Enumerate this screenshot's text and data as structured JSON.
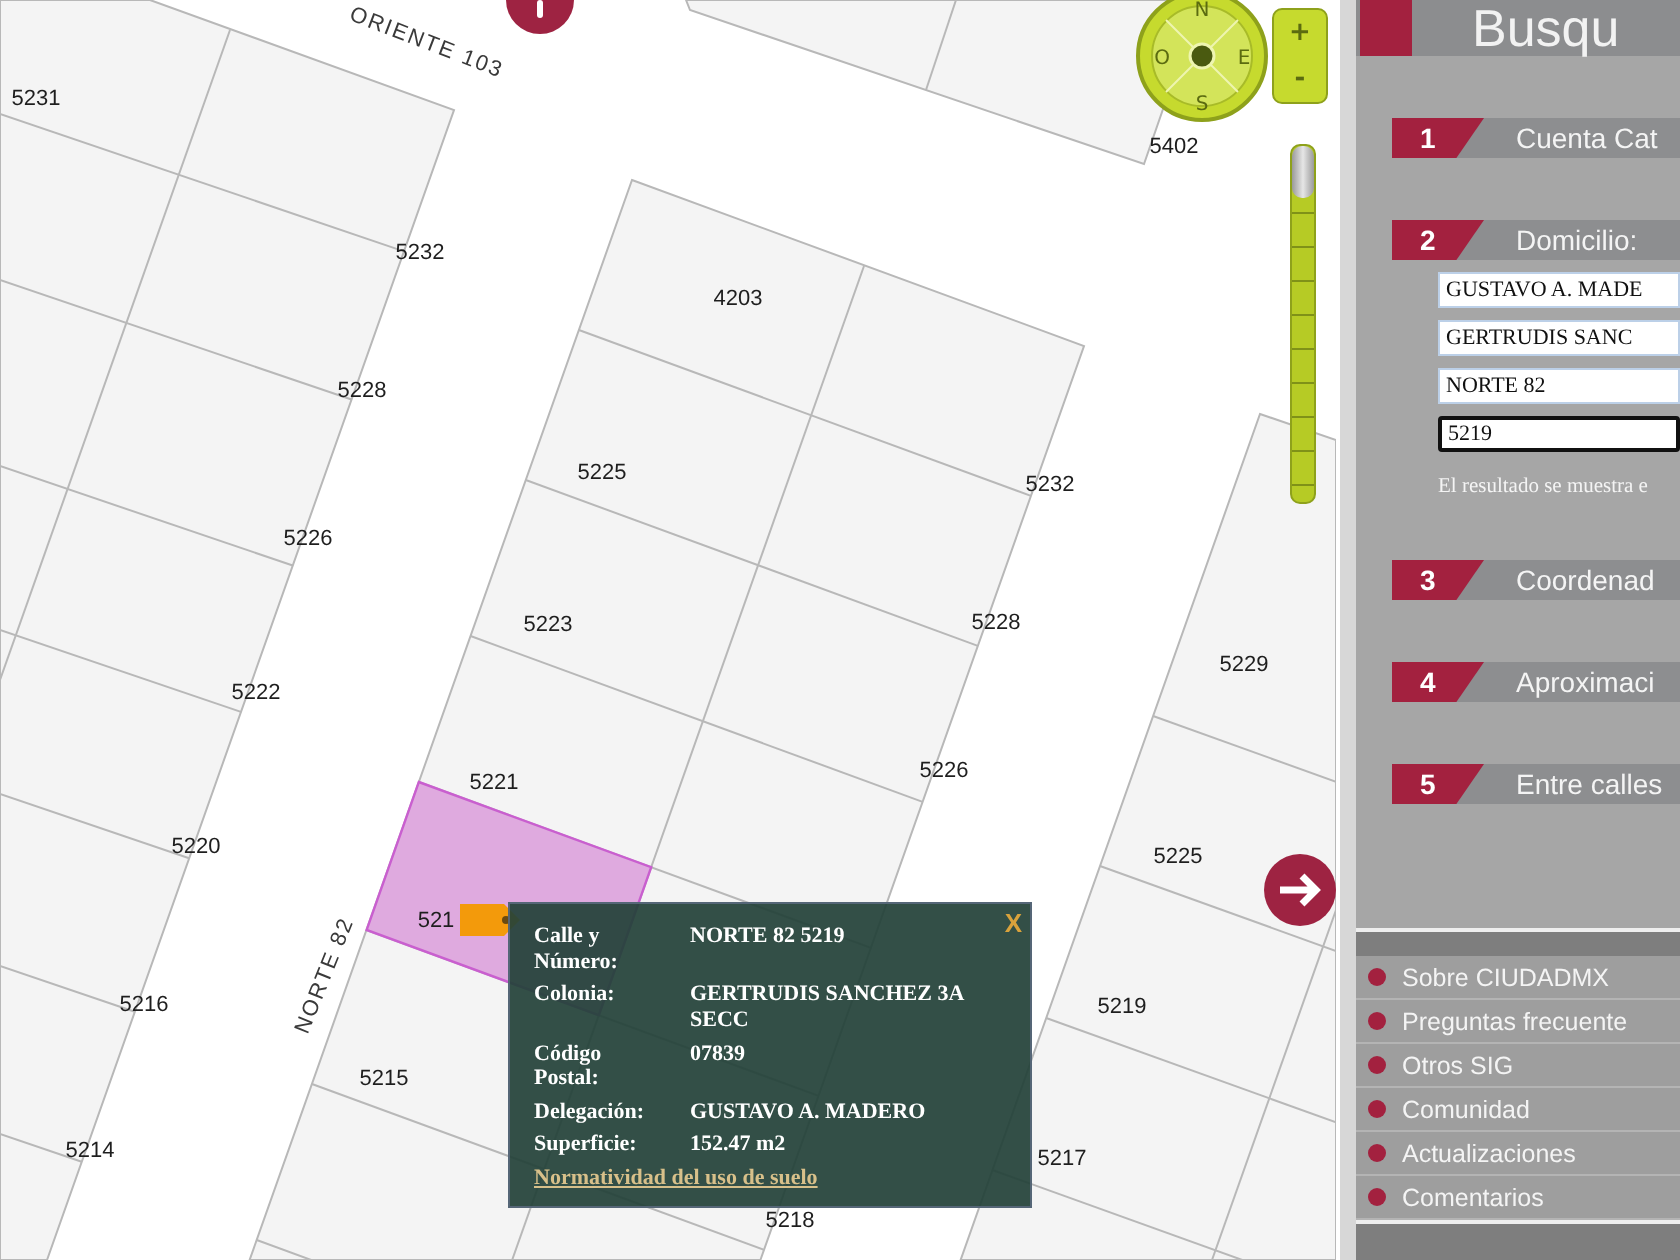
{
  "map": {
    "street_labels": [
      "ORIENTE 103",
      "NORTE 82"
    ],
    "lot_numbers": [
      "5231",
      "5232",
      "5228",
      "5226",
      "5222",
      "5220",
      "5216",
      "5214",
      "4203",
      "5225",
      "5232",
      "5223",
      "5228",
      "5221",
      "5226",
      "521",
      "5215",
      "5229",
      "5225",
      "5219",
      "5217",
      "5218",
      "5402"
    ],
    "compass": {
      "north": "N",
      "west": "O",
      "east": "E",
      "south": "S"
    },
    "zoom_buttons": [
      "+",
      "-"
    ],
    "zoom_slider": {
      "level": 1
    },
    "popup": {
      "close": "X",
      "rows": [
        {
          "label": "Calle y Número:",
          "value": "NORTE 82 5219"
        },
        {
          "label": "Colonia:",
          "value": "GERTRUDIS SANCHEZ 3A SECC"
        },
        {
          "label": "Código Postal:",
          "value": "07839"
        },
        {
          "label": "Delegación:",
          "value": "GUSTAVO A. MADERO"
        },
        {
          "label": "Superficie:",
          "value": "152.47 m2"
        }
      ],
      "link": "Normatividad del uso de suelo"
    }
  },
  "panel": {
    "title": "Busqu",
    "sections": [
      {
        "number": "1",
        "label": "Cuenta Cat"
      },
      {
        "number": "2",
        "label": "Domicilio:",
        "fields": [
          {
            "value": "GUSTAVO A. MADE",
            "focused": false
          },
          {
            "value": "GERTRUDIS SANC",
            "focused": false
          },
          {
            "value": "NORTE 82",
            "focused": false
          },
          {
            "value": "5219",
            "focused": true
          }
        ],
        "note": "El resultado se muestra e"
      },
      {
        "number": "3",
        "label": "Coordenad"
      },
      {
        "number": "4",
        "label": "Aproximaci"
      },
      {
        "number": "5",
        "label": "Entre calles"
      }
    ],
    "links": [
      "Sobre CIUDADMX",
      "Preguntas frecuente",
      "Otros SIG",
      "Comunidad",
      "Actualizaciones",
      "Comentarios"
    ]
  }
}
